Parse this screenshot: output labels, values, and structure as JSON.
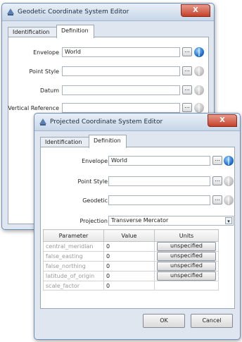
{
  "geodetic_editor": {
    "title": "Geodetic Coordinate System Editor",
    "close_label": "X",
    "tabs": [
      "Identification",
      "Definition"
    ],
    "fields": {
      "envelope": {
        "label": "Envelope",
        "value": "World"
      },
      "point_style": {
        "label": "Point Style",
        "value": ""
      },
      "datum": {
        "label": "Datum",
        "value": ""
      },
      "vertical_reference": {
        "label": "Vertical Reference",
        "value": ""
      }
    },
    "browse_label": "..."
  },
  "projected_editor": {
    "title": "Projected Coordinate System Editor",
    "close_label": "X",
    "tabs": [
      "Identification",
      "Definition"
    ],
    "fields": {
      "envelope": {
        "label": "Envelope",
        "value": "World"
      },
      "point_style": {
        "label": "Point Style",
        "value": ""
      },
      "geodetic": {
        "label": "Geodetic",
        "value": ""
      },
      "projection": {
        "label": "Projection",
        "value": "Transverse Mercator"
      }
    },
    "browse_label": "...",
    "dropdown_arrow": "▾",
    "table": {
      "headers": [
        "Parameter",
        "Value",
        "Units"
      ],
      "rows": [
        {
          "parameter": "central_meridian",
          "value": "0",
          "units": "unspecified"
        },
        {
          "parameter": "false_easting",
          "value": "0",
          "units": "unspecified"
        },
        {
          "parameter": "false_northing",
          "value": "0",
          "units": "unspecified"
        },
        {
          "parameter": "latitude_of_origin",
          "value": "0",
          "units": "unspecified"
        },
        {
          "parameter": "scale_factor",
          "value": "0",
          "units": ""
        }
      ]
    },
    "ok_label": "OK",
    "cancel_label": "Cancel"
  },
  "colors": {
    "active_globe": "#1e6ec8",
    "close_button": "#c3402a",
    "window_border": "#6d8fb5"
  },
  "icons": {
    "app": "app-icon",
    "globe": "globe-icon"
  }
}
